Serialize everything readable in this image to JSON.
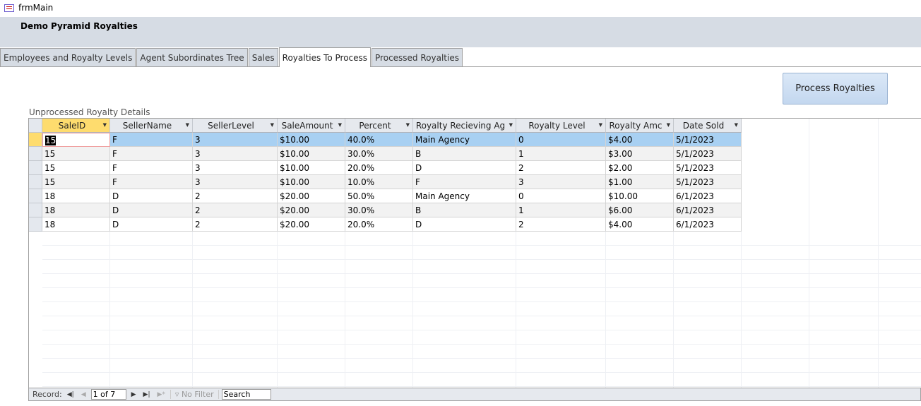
{
  "window": {
    "title": "frmMain"
  },
  "header": {
    "title": "Demo Pyramid Royalties"
  },
  "tabs": [
    {
      "label": "Employees and Royalty Levels"
    },
    {
      "label": "Agent Subordinates Tree"
    },
    {
      "label": "Sales"
    },
    {
      "label": "Royalties To Process"
    },
    {
      "label": "Processed Royalties"
    }
  ],
  "process_button": "Process Royalties",
  "subform_label": "Unprocessed Royalty Details",
  "columns": [
    "SaleID",
    "SellerName",
    "SellerLevel",
    "SaleAmount",
    "Percent",
    "Royalty Recieving Ag",
    "Royalty Level",
    "Royalty Amc",
    "Date Sold"
  ],
  "rows": [
    [
      "15",
      "F",
      "3",
      "$10.00",
      "40.0%",
      "Main Agency",
      "0",
      "$4.00",
      "5/1/2023"
    ],
    [
      "15",
      "F",
      "3",
      "$10.00",
      "30.0%",
      "B",
      "1",
      "$3.00",
      "5/1/2023"
    ],
    [
      "15",
      "F",
      "3",
      "$10.00",
      "20.0%",
      "D",
      "2",
      "$2.00",
      "5/1/2023"
    ],
    [
      "15",
      "F",
      "3",
      "$10.00",
      "10.0%",
      "F",
      "3",
      "$1.00",
      "5/1/2023"
    ],
    [
      "18",
      "D",
      "2",
      "$20.00",
      "50.0%",
      "Main Agency",
      "0",
      "$10.00",
      "6/1/2023"
    ],
    [
      "18",
      "D",
      "2",
      "$20.00",
      "30.0%",
      "B",
      "1",
      "$6.00",
      "6/1/2023"
    ],
    [
      "18",
      "D",
      "2",
      "$20.00",
      "20.0%",
      "D",
      "2",
      "$4.00",
      "6/1/2023"
    ]
  ],
  "navbar": {
    "record_label": "Record:",
    "position": "1 of 7",
    "filter": "No Filter",
    "search": "Search"
  }
}
